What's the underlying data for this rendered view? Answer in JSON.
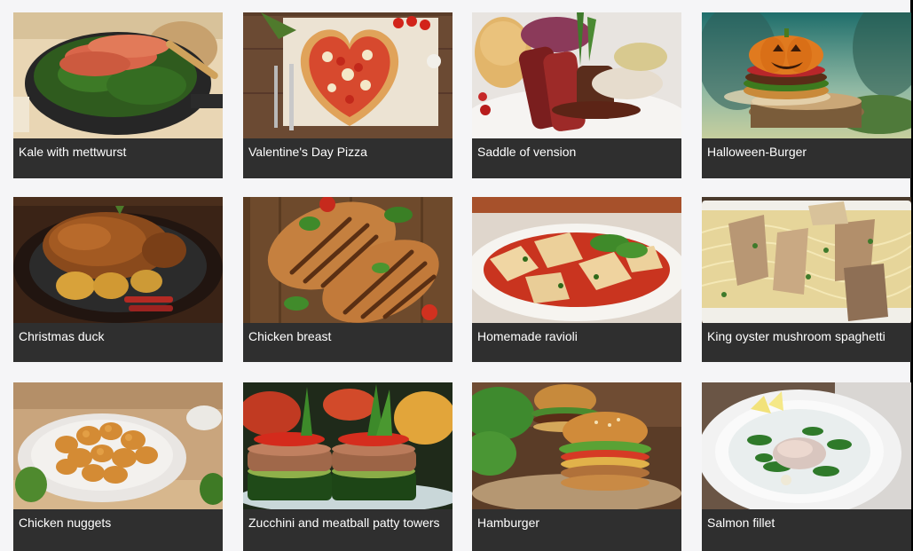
{
  "recipe_grid": {
    "recipes": [
      {
        "title": "Kale with mettwurst",
        "image_icon": "kale-mettwurst-photo"
      },
      {
        "title": "Valentine's Day Pizza",
        "image_icon": "heart-pizza-photo"
      },
      {
        "title": "Saddle of vension",
        "image_icon": "venison-photo"
      },
      {
        "title": "Halloween-Burger",
        "image_icon": "pumpkin-burger-photo"
      },
      {
        "title": "Christmas duck",
        "image_icon": "roast-duck-photo"
      },
      {
        "title": "Chicken breast",
        "image_icon": "grilled-chicken-photo"
      },
      {
        "title": "Homemade ravioli",
        "image_icon": "ravioli-photo"
      },
      {
        "title": "King oyster mushroom spaghetti",
        "image_icon": "mushroom-spaghetti-photo"
      },
      {
        "title": "Chicken nuggets",
        "image_icon": "chicken-nuggets-photo"
      },
      {
        "title": "Zucchini and meatball patty towers",
        "image_icon": "zucchini-towers-photo"
      },
      {
        "title": "Hamburger",
        "image_icon": "hamburger-photo"
      },
      {
        "title": "Salmon fillet",
        "image_icon": "salmon-fillet-photo"
      }
    ]
  },
  "colors": {
    "page_background": "#f5f5f7",
    "caption_bar": "#2f2f2f",
    "caption_text": "#ffffff"
  }
}
